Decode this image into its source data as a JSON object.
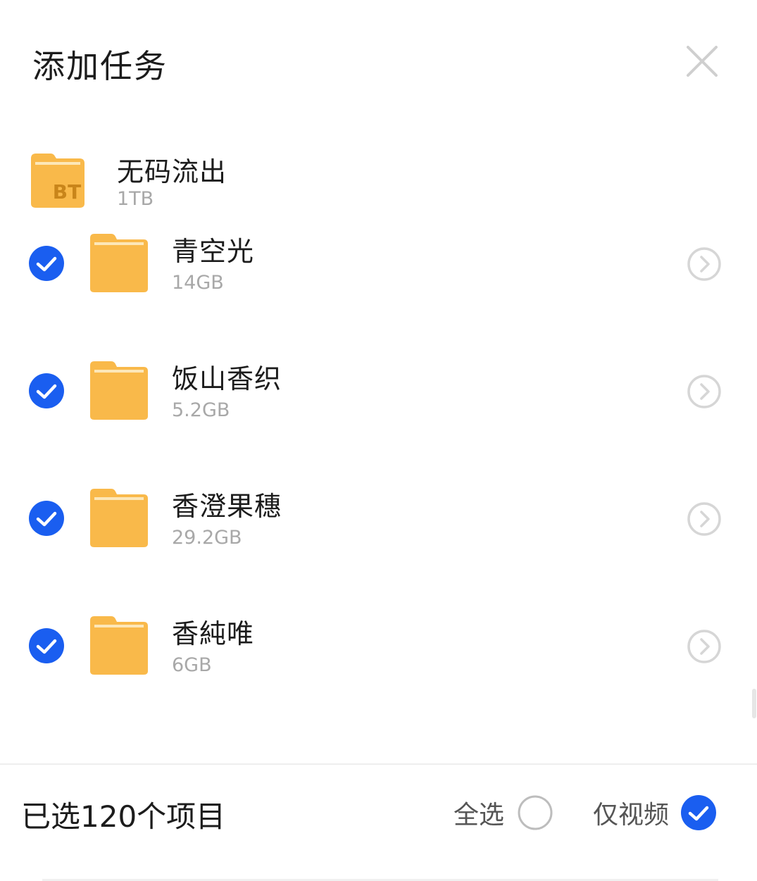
{
  "header": {
    "title": "添加任务"
  },
  "parent_folder": {
    "name": "无码流出",
    "size": "1TB",
    "badge": "BT"
  },
  "items": [
    {
      "name": "青空光",
      "size": "14GB",
      "checked": true
    },
    {
      "name": "饭山香织",
      "size": "5.2GB",
      "checked": true
    },
    {
      "name": "香澄果穗",
      "size": "29.2GB",
      "checked": true
    },
    {
      "name": "香純唯",
      "size": "6GB",
      "checked": true
    }
  ],
  "footer": {
    "selected_text": "已选120个项目",
    "select_all_label": "全选",
    "select_all_checked": false,
    "video_only_label": "仅视频",
    "video_only_checked": true
  },
  "colors": {
    "accent": "#1a5ef0",
    "folder": "#f9b94a",
    "folder_tab": "#fcd079",
    "bt_text": "#c9851a",
    "muted_text": "#a8a8a8",
    "icon_gray": "#d6d6d6"
  }
}
